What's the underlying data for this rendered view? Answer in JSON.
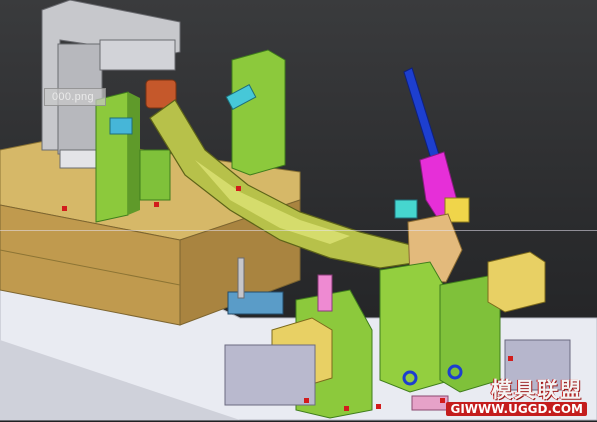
{
  "viewport": {
    "file_label": "000.png",
    "background": "#2b2c2e"
  },
  "watermark": {
    "title": "模具联盟",
    "url": "GIWWW.UGGD.COM"
  },
  "colors": {
    "base_plate": "#e9ebf2",
    "table_wood": "#c8a860",
    "fixture_green": "#88c83a",
    "dark_green": "#3f7d1c",
    "part_olive": "#b9c24a",
    "gray_frame": "#c6c6ca",
    "blue_handle": "#1d3fcf",
    "magenta": "#e62fd8",
    "yellow_block": "#e8d064",
    "cyan": "#46c8d8",
    "red_marker": "#d21c1c"
  }
}
